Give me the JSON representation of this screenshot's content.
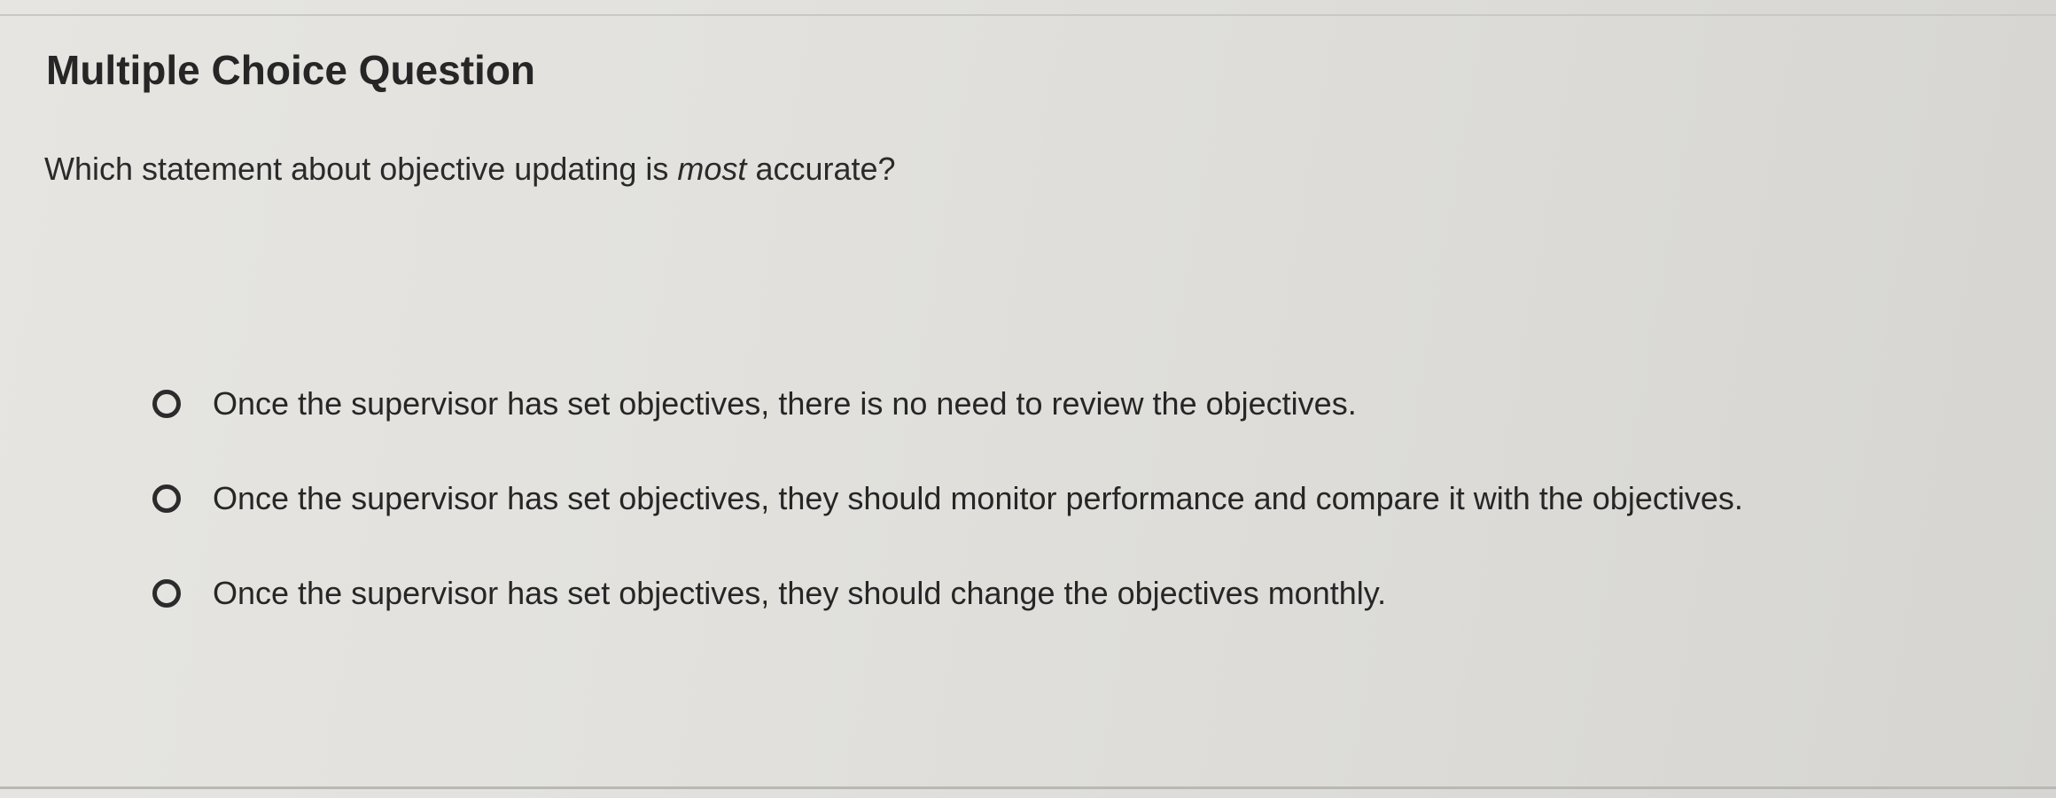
{
  "header": {
    "title": "Multiple Choice Question"
  },
  "question": {
    "text_before": "Which statement about objective updating is ",
    "emphasis": "most",
    "text_after": " accurate?"
  },
  "options": [
    {
      "label": "Once the supervisor has set objectives, there is no need to review the objectives.",
      "selected": false
    },
    {
      "label": "Once the supervisor has set objectives, they should monitor performance and compare it with the objectives.",
      "selected": false
    },
    {
      "label": "Once the supervisor has set objectives, they should change the objectives monthly.",
      "selected": false
    }
  ],
  "colors": {
    "background": "#e2e1dd",
    "text": "#262626",
    "radio_border": "#2b2b2b"
  },
  "icons": {
    "radio": "radio-unselected-icon"
  }
}
